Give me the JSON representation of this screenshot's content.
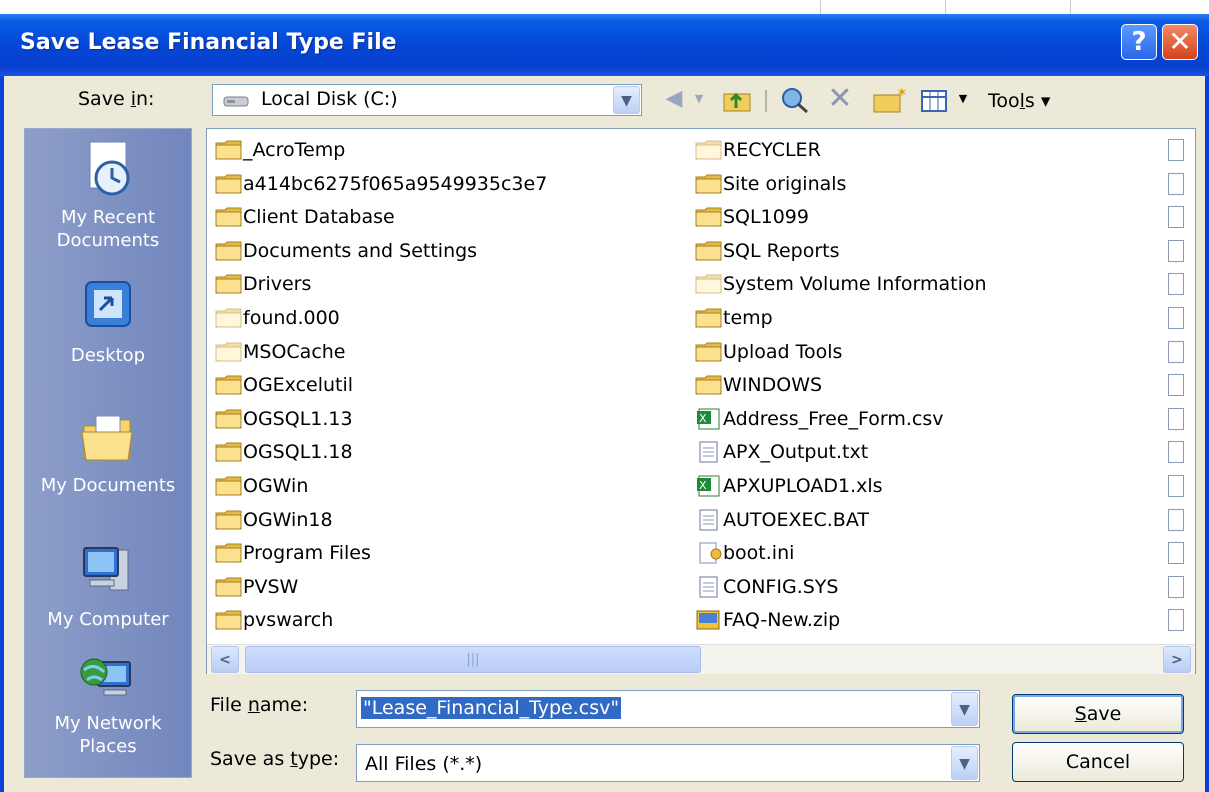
{
  "window": {
    "title": "Save Lease Financial Type File",
    "help_icon": "?",
    "close_icon": "✕"
  },
  "background_text": "",
  "save_in": {
    "label": "Save in:",
    "value": "Local Disk (C:)"
  },
  "toolbar": {
    "tools_label": "Tools"
  },
  "places": [
    {
      "id": "recent",
      "label_lines": [
        "My Recent",
        "Documents"
      ],
      "icon": "recent-documents-icon"
    },
    {
      "id": "desktop",
      "label_lines": [
        "Desktop"
      ],
      "icon": "desktop-icon"
    },
    {
      "id": "documents",
      "label_lines": [
        "My Documents"
      ],
      "icon": "my-documents-icon"
    },
    {
      "id": "computer",
      "label_lines": [
        "My Computer"
      ],
      "icon": "my-computer-icon"
    },
    {
      "id": "network",
      "label_lines": [
        "My Network",
        "Places"
      ],
      "icon": "network-places-icon"
    }
  ],
  "files_col1": [
    {
      "name": "_AcroTemp",
      "type": "folder"
    },
    {
      "name": "a414bc6275f065a9549935c3e7",
      "type": "folder"
    },
    {
      "name": "Client Database",
      "type": "folder"
    },
    {
      "name": "Documents and Settings",
      "type": "folder"
    },
    {
      "name": "Drivers",
      "type": "folder"
    },
    {
      "name": "found.000",
      "type": "folder-hidden"
    },
    {
      "name": "MSOCache",
      "type": "folder-hidden"
    },
    {
      "name": "OGExcelutil",
      "type": "folder"
    },
    {
      "name": "OGSQL1.13",
      "type": "folder"
    },
    {
      "name": "OGSQL1.18",
      "type": "folder"
    },
    {
      "name": "OGWin",
      "type": "folder"
    },
    {
      "name": "OGWin18",
      "type": "folder"
    },
    {
      "name": "Program Files",
      "type": "folder"
    },
    {
      "name": "PVSW",
      "type": "folder"
    },
    {
      "name": "pvswarch",
      "type": "folder"
    }
  ],
  "files_col2": [
    {
      "name": "RECYCLER",
      "type": "folder-hidden"
    },
    {
      "name": "Site originals",
      "type": "folder"
    },
    {
      "name": "SQL1099",
      "type": "folder"
    },
    {
      "name": "SQL Reports",
      "type": "folder"
    },
    {
      "name": "System Volume Information",
      "type": "folder-hidden"
    },
    {
      "name": "temp",
      "type": "folder"
    },
    {
      "name": "Upload Tools",
      "type": "folder"
    },
    {
      "name": "WINDOWS",
      "type": "folder"
    },
    {
      "name": "Address_Free_Form.csv",
      "type": "csv"
    },
    {
      "name": "APX_Output.txt",
      "type": "txt"
    },
    {
      "name": "APXUPLOAD1.xls",
      "type": "xls"
    },
    {
      "name": "AUTOEXEC.BAT",
      "type": "bat"
    },
    {
      "name": "boot.ini",
      "type": "ini"
    },
    {
      "name": "CONFIG.SYS",
      "type": "sys"
    },
    {
      "name": "FAQ-New.zip",
      "type": "zip"
    }
  ],
  "file_name": {
    "label": "File name:",
    "value": "\"Lease_Financial_Type.csv\""
  },
  "save_as_type": {
    "label": "Save as type:",
    "value": "All Files (*.*)"
  },
  "buttons": {
    "save": "Save",
    "cancel": "Cancel"
  },
  "colors": {
    "title_bar": "#0547d6",
    "dialog_bg": "#ece9d8",
    "places_bar": "#7b8fc0",
    "selection": "#316ac5"
  }
}
